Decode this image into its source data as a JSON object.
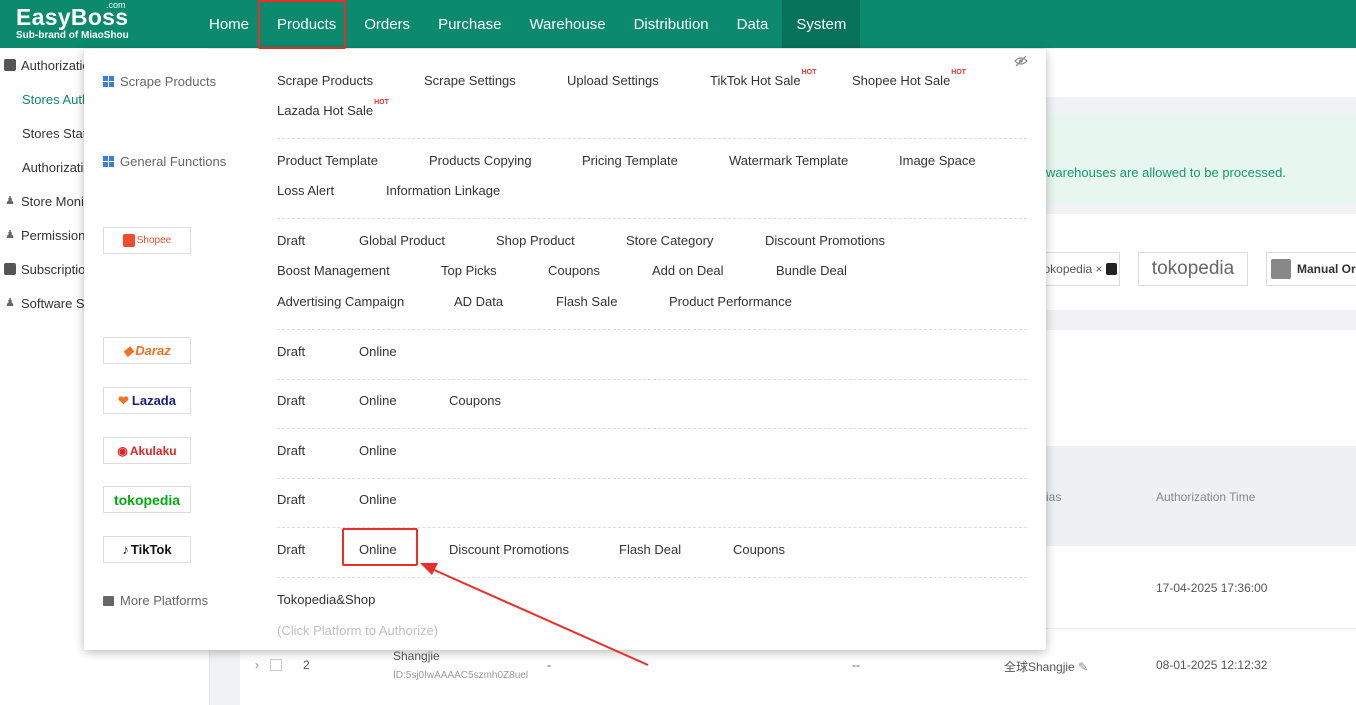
{
  "logo": {
    "brand": "EasyBoss",
    "com": ".com",
    "sub": "Sub-brand of MiaoShou"
  },
  "nav": [
    "Home",
    "Products",
    "Orders",
    "Purchase",
    "Warehouse",
    "Distribution",
    "Data",
    "System"
  ],
  "sidebar": {
    "authorization": "Authorizatio",
    "stores_auth": "Stores Auth",
    "stores_stat": "Stores Stat",
    "authorizatio2": "Authorizatio",
    "store_monitor": "Store Monit",
    "permissions": "Permissions",
    "subscription": "Subscription",
    "software": "Software Se"
  },
  "content": {
    "tip": "warehouses are allowed to be processed.",
    "platform_cards": [
      "okopedia ×",
      "tokopedia",
      "Manual Or"
    ],
    "table_headers": {
      "alias": "ias",
      "auth_time": "Authorization Time"
    },
    "rows": [
      {
        "time": "17-04-2025 17:36:00"
      },
      {
        "index": "2",
        "name": "Shangjie",
        "id": "ID:5sj0IwAAAAC5szmh0Z8uel",
        "col_a": "-",
        "col_b": "--",
        "alias": "全球Shangjie",
        "time": "08-01-2025 12:12:32"
      }
    ]
  },
  "dropdown": {
    "categories": {
      "scrape": "Scrape Products",
      "general": "General Functions",
      "more": "More Platforms"
    },
    "scrape_items": [
      "Scrape Products",
      "Scrape Settings",
      "Upload Settings",
      "TikTok Hot Sale",
      "Shopee Hot Sale",
      "Lazada Hot Sale"
    ],
    "hot_label": "HOT",
    "general_items": [
      "Product Template",
      "Products Copying",
      "Pricing Template",
      "Watermark Template",
      "Image Space",
      "Loss Alert",
      "Information Linkage"
    ],
    "platforms": {
      "shopee": {
        "logo": "Shopee",
        "color": "#ee4d2d",
        "items": [
          "Draft",
          "Global Product",
          "Shop Product",
          "Store Category",
          "Discount Promotions",
          "Boost Management",
          "Top Picks",
          "Coupons",
          "Add on Deal",
          "Bundle Deal",
          "Advertising Campaign",
          "AD Data",
          "Flash Sale",
          "Product Performance"
        ]
      },
      "daraz": {
        "logo": "Daraz",
        "color": "#f36f21",
        "items": [
          "Draft",
          "Online"
        ]
      },
      "lazada": {
        "logo": "Lazada",
        "color": "#1a1e7d",
        "items": [
          "Draft",
          "Online",
          "Coupons"
        ]
      },
      "akulaku": {
        "logo": "Akulaku",
        "color": "#e02525",
        "items": [
          "Draft",
          "Online"
        ]
      },
      "tokopedia": {
        "logo": "tokopedia",
        "color": "#03ac0e",
        "items": [
          "Draft",
          "Online"
        ]
      },
      "tiktok": {
        "logo": "TikTok",
        "color": "#111111",
        "items": [
          "Draft",
          "Online",
          "Discount Promotions",
          "Flash Deal",
          "Coupons"
        ]
      }
    },
    "more_items": [
      "Tokopedia&Shop"
    ],
    "more_note": "(Click Platform to Authorize)"
  },
  "colors": {
    "brand": "#0b8a6e",
    "highlight": "#e8302a",
    "link": "#0b8a6e"
  }
}
